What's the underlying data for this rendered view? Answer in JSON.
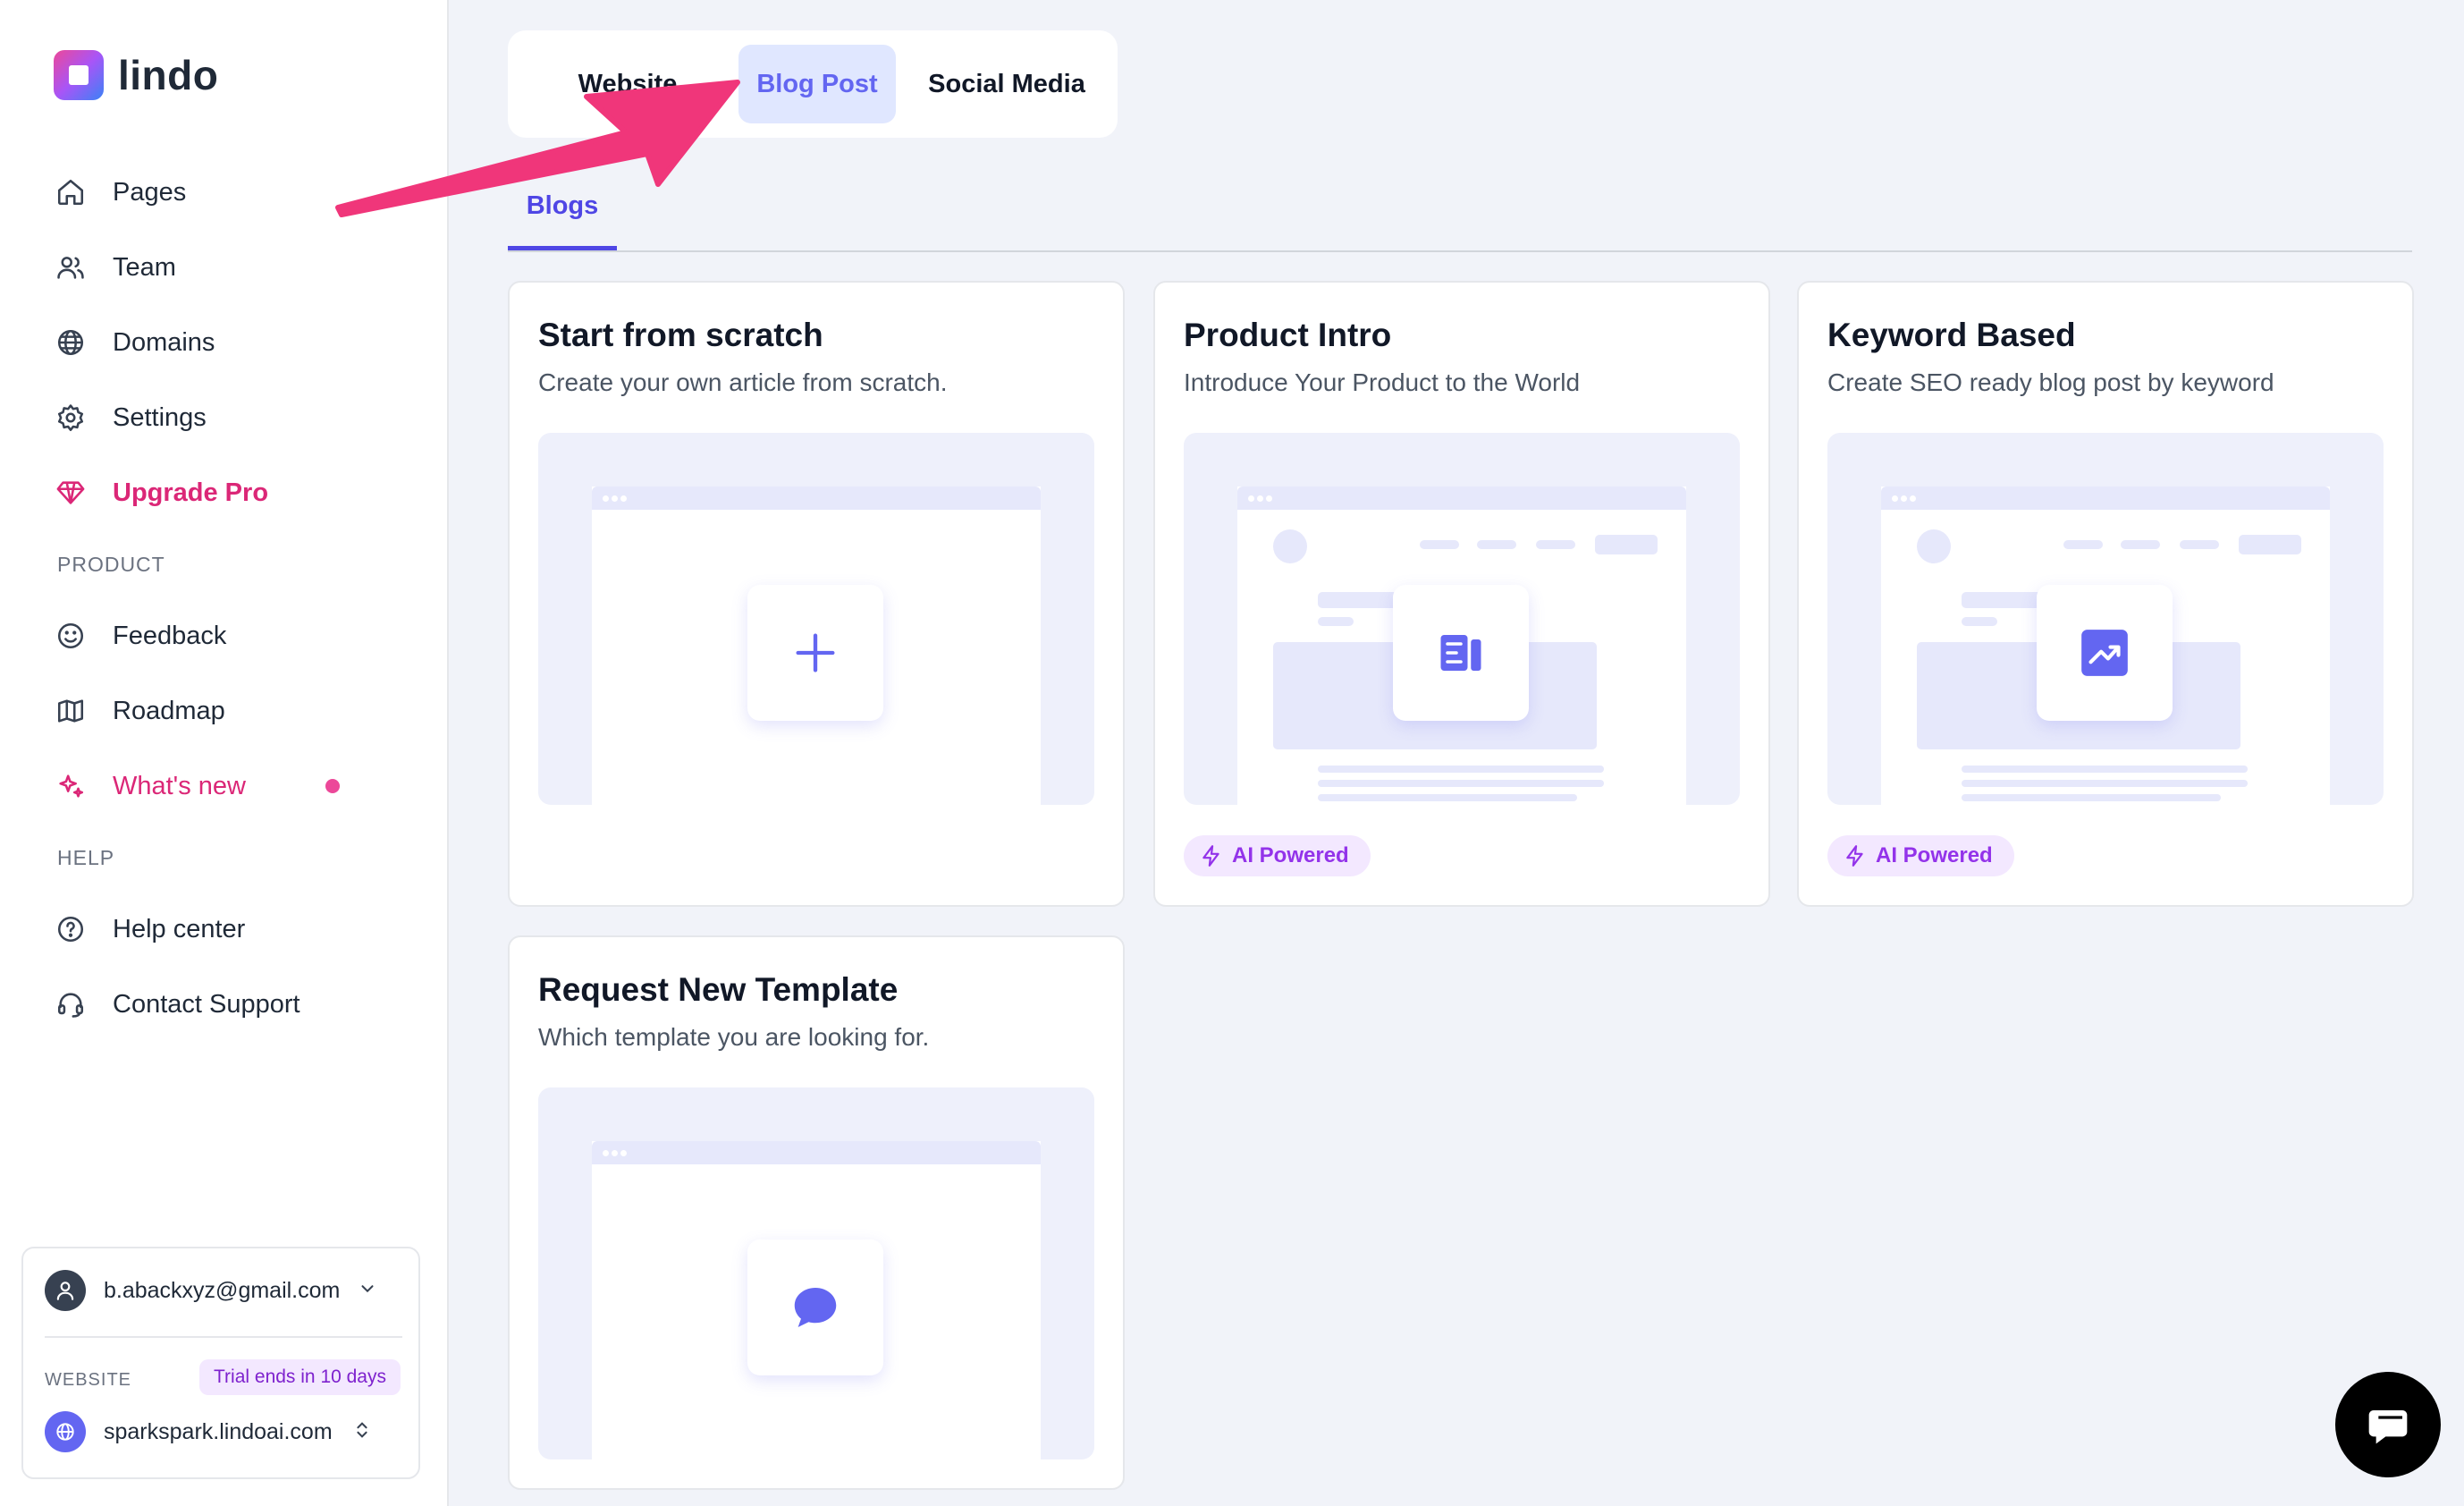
{
  "brand": {
    "name": "lindo"
  },
  "sidebar": {
    "items": [
      {
        "label": "Pages",
        "icon": "home-icon"
      },
      {
        "label": "Team",
        "icon": "users-icon"
      },
      {
        "label": "Domains",
        "icon": "globe-icon"
      },
      {
        "label": "Settings",
        "icon": "gear-icon"
      },
      {
        "label": "Upgrade Pro",
        "icon": "diamond-icon"
      }
    ],
    "product_label": "PRODUCT",
    "product_items": [
      {
        "label": "Feedback",
        "icon": "smiley-icon"
      },
      {
        "label": "Roadmap",
        "icon": "map-icon"
      },
      {
        "label": "What's new",
        "icon": "sparkle-icon"
      }
    ],
    "help_label": "HELP",
    "help_items": [
      {
        "label": "Help center",
        "icon": "question-circle-icon"
      },
      {
        "label": "Contact Support",
        "icon": "headset-icon"
      }
    ]
  },
  "account": {
    "email": "b.abackxyz@gmail.com",
    "website_label": "WEBSITE",
    "trial": "Trial ends in 10 days",
    "website": "sparkspark.lindoai.com"
  },
  "tabs": [
    {
      "label": "Website"
    },
    {
      "label": "Blog Post"
    },
    {
      "label": "Social Media"
    }
  ],
  "subtab": {
    "label": "Blogs"
  },
  "cards": [
    {
      "title": "Start from scratch",
      "desc": "Create your own article from scratch.",
      "icon": "plus-icon"
    },
    {
      "title": "Product Intro",
      "desc": "Introduce Your Product to the World",
      "icon": "article-icon",
      "badge": "AI Powered"
    },
    {
      "title": "Keyword Based",
      "desc": "Create SEO ready blog post by keyword",
      "icon": "trending-up-icon",
      "badge": "AI Powered"
    },
    {
      "title": "Request New Template",
      "desc": "Which template you are looking for.",
      "icon": "chat-bubble-icon"
    }
  ],
  "colors": {
    "accent": "#6366f1",
    "pink": "#db2777",
    "arrow": "#f0367a",
    "badge_text": "#9333ea"
  }
}
